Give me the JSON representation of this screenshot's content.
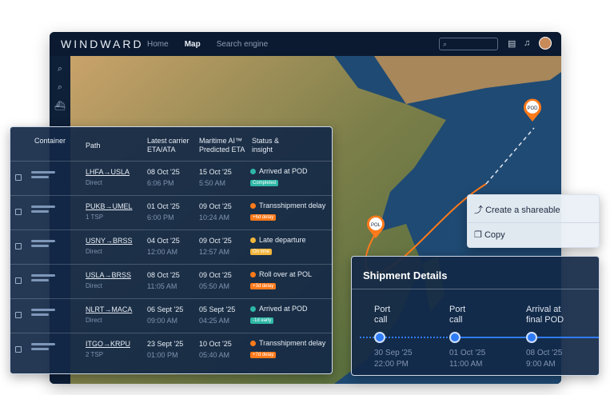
{
  "app": {
    "logo": "WINDWARD",
    "nav": [
      "Home",
      "Map",
      "Search engine"
    ]
  },
  "table": {
    "headers": {
      "container": "Container",
      "path": "Path",
      "carrier": "Latest carrier ETA/ATA",
      "ai": "Maritime AI™ Predicted ETA",
      "status": "Status & insight"
    },
    "rows": [
      {
        "path": "LHFA→USLA",
        "route": "Direct",
        "carrier_date": "08 Oct '25",
        "carrier_time": "6:06 PM",
        "ai_date": "15 Oct '25",
        "ai_time": "5:50 AM",
        "status": "Arrived at POD",
        "badge": "Completed",
        "color": "#2fb7a6"
      },
      {
        "path": "PUKB→UMEL",
        "route": "1 TSP",
        "carrier_date": "01 Oct '25",
        "carrier_time": "6:00 PM",
        "ai_date": "09 Oct '25",
        "ai_time": "10:24 AM",
        "status": "Transshipment delay",
        "badge": "+6d delay",
        "color": "#ff7a1a"
      },
      {
        "path": "USNY→BRSS",
        "route": "Direct",
        "carrier_date": "04 Oct '25",
        "carrier_time": "12:00 AM",
        "ai_date": "09 Oct '25",
        "ai_time": "12:57 AM",
        "status": "Late departure",
        "badge": "On time",
        "color": "#f2b53c"
      },
      {
        "path": "USLA→BRSS",
        "route": "Direct",
        "carrier_date": "08 Oct '25",
        "carrier_time": "11:05 AM",
        "ai_date": "09 Oct '25",
        "ai_time": "05:50 AM",
        "status": "Roll over at POL",
        "badge": "+3d delay",
        "color": "#ff7a1a"
      },
      {
        "path": "NLRT→MACA",
        "route": "Direct",
        "carrier_date": "06 Sept '25",
        "carrier_time": "09:00 AM",
        "ai_date": "05 Sept '25",
        "ai_time": "04:25 AM",
        "status": "Arrived at POD",
        "badge": "-1d early",
        "color": "#2fb7a6"
      },
      {
        "path": "ITGO→KRPU",
        "route": "2 TSP",
        "carrier_date": "23 Sept '25",
        "carrier_time": "01:00 PM",
        "ai_date": "10 Oct '25",
        "ai_time": "05:40 AM",
        "status": "Transshipment delay",
        "badge": "+7d delay",
        "color": "#ff7a1a"
      }
    ]
  },
  "map": {
    "pol": "POL",
    "pod": "POD"
  },
  "share": {
    "create": "Create a shareable",
    "copy": "Copy"
  },
  "details": {
    "title": "Shipment Details",
    "stops": [
      {
        "l1": "Port",
        "l2": "call",
        "date": "30 Sep '25",
        "time": "22:00 PM"
      },
      {
        "l1": "Port",
        "l2": "call",
        "date": "01 Oct '25",
        "time": "11:00 AM"
      },
      {
        "l1": "Arrival at",
        "l2": "final POD",
        "date": "08 Oct '25",
        "time": "9:00 AM"
      }
    ]
  }
}
